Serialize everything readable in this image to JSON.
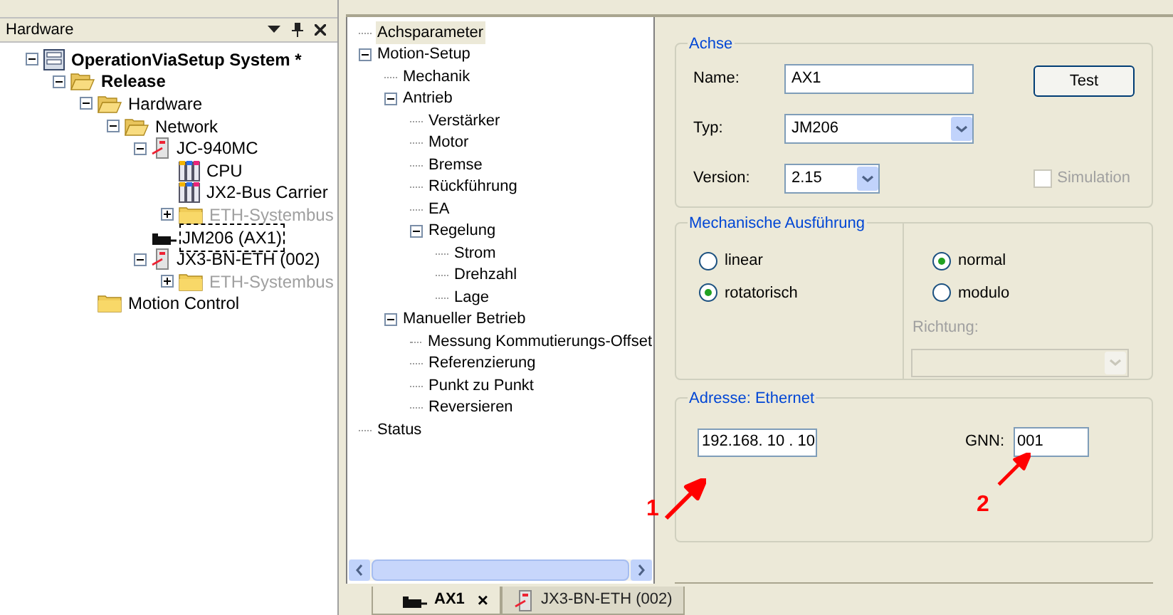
{
  "hardware_panel": {
    "title": "Hardware",
    "tree": [
      {
        "label": "OperationViaSetup System *",
        "kind": "system",
        "bold": true,
        "expanded": true,
        "children": [
          {
            "label": "Release",
            "kind": "folder-open",
            "bold": true,
            "expanded": true,
            "children": [
              {
                "label": "Hardware",
                "kind": "folder-open",
                "expanded": true,
                "children": [
                  {
                    "label": "Network",
                    "kind": "folder-open",
                    "expanded": true,
                    "children": [
                      {
                        "label": "JC-940MC",
                        "kind": "device",
                        "expanded": true,
                        "children": [
                          {
                            "label": "CPU",
                            "kind": "module"
                          },
                          {
                            "label": "JX2-Bus Carrier",
                            "kind": "module"
                          },
                          {
                            "label": "ETH-Systembus",
                            "kind": "folder",
                            "disabled": true,
                            "expanded": false
                          }
                        ]
                      },
                      {
                        "label": "JM206 (AX1)",
                        "kind": "motor",
                        "selected": true
                      },
                      {
                        "label": "JX3-BN-ETH (002)",
                        "kind": "device",
                        "expanded": true,
                        "children": [
                          {
                            "label": "ETH-Systembus",
                            "kind": "folder",
                            "disabled": true,
                            "expanded": false
                          }
                        ]
                      }
                    ]
                  }
                ]
              },
              {
                "label": "Motion Control",
                "kind": "folder"
              }
            ]
          }
        ]
      }
    ]
  },
  "settings_tree": [
    {
      "label": "Achsparameter",
      "selected": true
    },
    {
      "label": "Motion-Setup",
      "expanded": true,
      "children": [
        {
          "label": "Mechanik"
        },
        {
          "label": "Antrieb",
          "expanded": true,
          "children": [
            {
              "label": "Verstärker"
            },
            {
              "label": "Motor"
            },
            {
              "label": "Bremse"
            },
            {
              "label": "Rückführung"
            },
            {
              "label": "EA"
            },
            {
              "label": "Regelung",
              "expanded": true,
              "children": [
                {
                  "label": "Strom"
                },
                {
                  "label": "Drehzahl"
                },
                {
                  "label": "Lage"
                }
              ]
            }
          ]
        },
        {
          "label": "Manueller Betrieb",
          "expanded": true,
          "children": [
            {
              "label": "Messung Kommutierungs-Offset"
            },
            {
              "label": "Referenzierung"
            },
            {
              "label": "Punkt zu Punkt"
            },
            {
              "label": "Reversieren"
            }
          ]
        }
      ]
    },
    {
      "label": "Status"
    }
  ],
  "achse": {
    "title": "Achse",
    "name_label": "Name:",
    "name_value": "AX1",
    "typ_label": "Typ:",
    "typ_value": "JM206",
    "version_label": "Version:",
    "version_value": "2.15",
    "test_button": "Test",
    "simulation": {
      "label": "Simulation",
      "checked": false,
      "disabled": true
    }
  },
  "mechanische_ausfuehrung": {
    "title": "Mechanische Ausführung",
    "motion_type": [
      {
        "label": "linear",
        "selected": false
      },
      {
        "label": "rotatorisch",
        "selected": true
      }
    ],
    "range": [
      {
        "label": "normal",
        "selected": true
      },
      {
        "label": "modulo",
        "selected": false
      }
    ],
    "richtung_label": "Richtung:"
  },
  "adresse": {
    "title": "Adresse: Ethernet",
    "ip_value": "192.168. 10 . 10",
    "gnn_label": "GNN:",
    "gnn_value": "001"
  },
  "annotations": [
    "1",
    "2"
  ],
  "tabs": [
    {
      "label": "AX1",
      "kind": "motor",
      "selected": true,
      "close": "×"
    },
    {
      "label": "JX3-BN-ETH (002)",
      "kind": "device",
      "selected": false
    }
  ]
}
